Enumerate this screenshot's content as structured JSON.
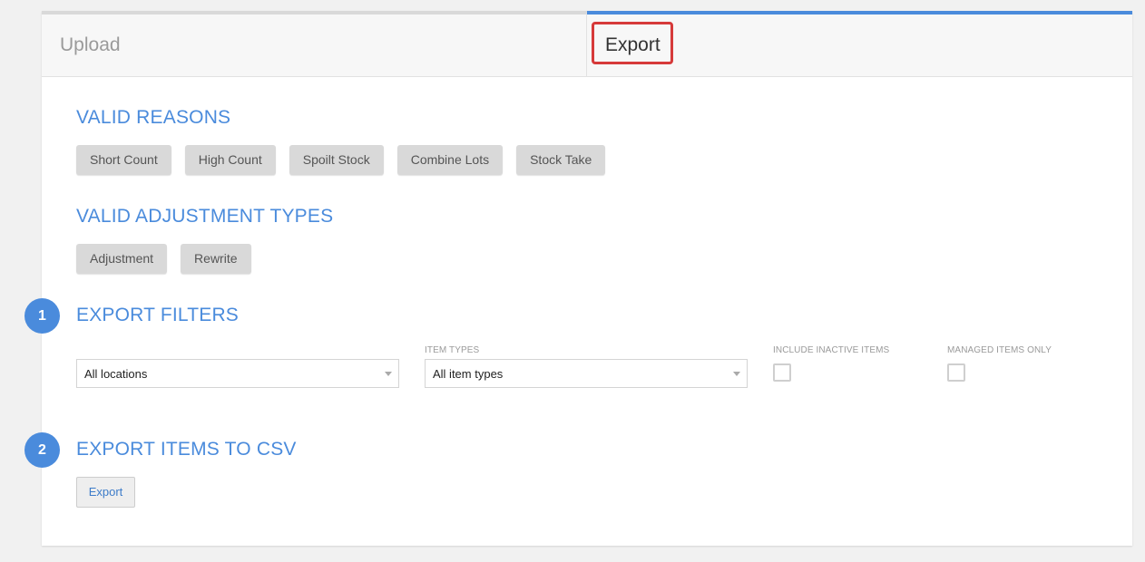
{
  "tabs": {
    "upload_label": "Upload",
    "export_label": "Export",
    "active": "export"
  },
  "valid_reasons": {
    "title": "VALID REASONS",
    "items": [
      "Short Count",
      "High Count",
      "Spoilt Stock",
      "Combine Lots",
      "Stock Take"
    ]
  },
  "valid_adjustment_types": {
    "title": "VALID ADJUSTMENT TYPES",
    "items": [
      "Adjustment",
      "Rewrite"
    ]
  },
  "export_filters": {
    "step": "1",
    "title": "EXPORT FILTERS",
    "location_select": {
      "value": "All locations"
    },
    "item_types": {
      "label": "ITEM TYPES",
      "value": "All item types"
    },
    "include_inactive": {
      "label": "INCLUDE INACTIVE ITEMS",
      "checked": false
    },
    "managed_only": {
      "label": "MANAGED ITEMS ONLY",
      "checked": false
    }
  },
  "export_csv": {
    "step": "2",
    "title": "EXPORT ITEMS TO CSV",
    "button_label": "Export"
  },
  "colors": {
    "accent": "#4a8bdc",
    "highlight": "#d63a3a",
    "chip_bg": "#d9d9d9"
  }
}
